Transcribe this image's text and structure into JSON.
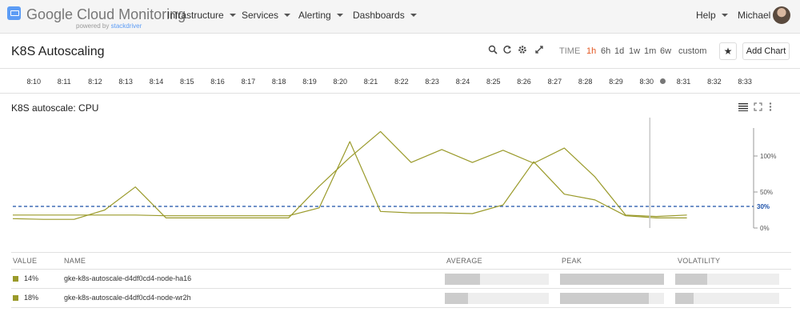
{
  "header": {
    "brand": "Google Cloud Monitoring",
    "brand_sub_prefix": "powered by ",
    "brand_sub_name": "stackdriver",
    "nav": [
      "Infrastructure",
      "Services",
      "Alerting",
      "Dashboards"
    ],
    "help": "Help",
    "user": "Michael"
  },
  "titlebar": {
    "title": "K8S Autoscaling",
    "time_label": "TIME",
    "ranges": [
      "1h",
      "6h",
      "1d",
      "1w",
      "1m",
      "6w",
      "custom"
    ],
    "active_range": "1h",
    "add_chart": "Add Chart",
    "icons": [
      "search-icon",
      "refresh-icon",
      "settings-icon",
      "fullscreen-icon",
      "star-icon"
    ]
  },
  "timeline": {
    "ticks": [
      "8:10",
      "8:11",
      "8:12",
      "8:13",
      "8:14",
      "8:15",
      "8:16",
      "8:17",
      "8:18",
      "8:19",
      "8:20",
      "8:21",
      "8:22",
      "8:23",
      "8:24",
      "8:25",
      "8:26",
      "8:27",
      "8:28",
      "8:29",
      "8:30",
      "8:31",
      "8:32",
      "8:33"
    ]
  },
  "chart": {
    "title": "K8S autoscale: CPU",
    "icons": [
      "list-icon",
      "expand-icon",
      "more-vert-icon"
    ]
  },
  "chart_data": {
    "type": "line",
    "title": "K8S autoscale: CPU",
    "ylim": [
      0,
      130
    ],
    "ytick_labels": [
      "100%",
      "50%",
      "0%"
    ],
    "ytick_values": [
      100,
      50,
      0
    ],
    "threshold": {
      "value": 30,
      "label": "30%",
      "style": "dashed",
      "color": "#1a4fa8"
    },
    "x": [
      "8:10",
      "8:11",
      "8:12",
      "8:13",
      "8:14",
      "8:15",
      "8:16",
      "8:17",
      "8:18",
      "8:19",
      "8:20",
      "8:21",
      "8:22",
      "8:23",
      "8:24",
      "8:25",
      "8:26",
      "8:27",
      "8:28",
      "8:29",
      "8:30",
      "8:31",
      "8:32",
      "8:33"
    ],
    "series": [
      {
        "name": "gke-k8s-autoscale-d4df0cd4-node-ha16",
        "color": "#9a9a2a",
        "values": [
          18,
          18,
          18,
          18,
          18,
          17,
          17,
          17,
          17,
          17,
          28,
          120,
          23,
          21,
          21,
          20,
          32,
          92,
          47,
          39,
          17,
          14,
          14,
          null
        ]
      },
      {
        "name": "gke-k8s-autoscale-d4df0cd4-node-wr2h",
        "color": "#9a9a2a",
        "values": [
          13,
          12,
          12,
          25,
          57,
          14,
          14,
          14,
          14,
          14,
          58,
          98,
          134,
          91,
          109,
          91,
          108,
          90,
          111,
          71,
          18,
          16,
          18,
          null
        ]
      }
    ],
    "cursor_x": "8:31",
    "grid": false,
    "legend": "bottom"
  },
  "legend_table": {
    "headers": [
      "VALUE",
      "NAME",
      "AVERAGE",
      "PEAK",
      "VOLATILITY"
    ],
    "rows": [
      {
        "color": "#9a9a2a",
        "value": "14%",
        "name": "gke-k8s-autoscale-d4df0cd4-node-ha16",
        "average": 0.34,
        "peak": 1.0,
        "volatility": 0.31
      },
      {
        "color": "#9a9a2a",
        "value": "18%",
        "name": "gke-k8s-autoscale-d4df0cd4-node-wr2h",
        "average": 0.22,
        "peak": 0.85,
        "volatility": 0.18
      }
    ]
  }
}
